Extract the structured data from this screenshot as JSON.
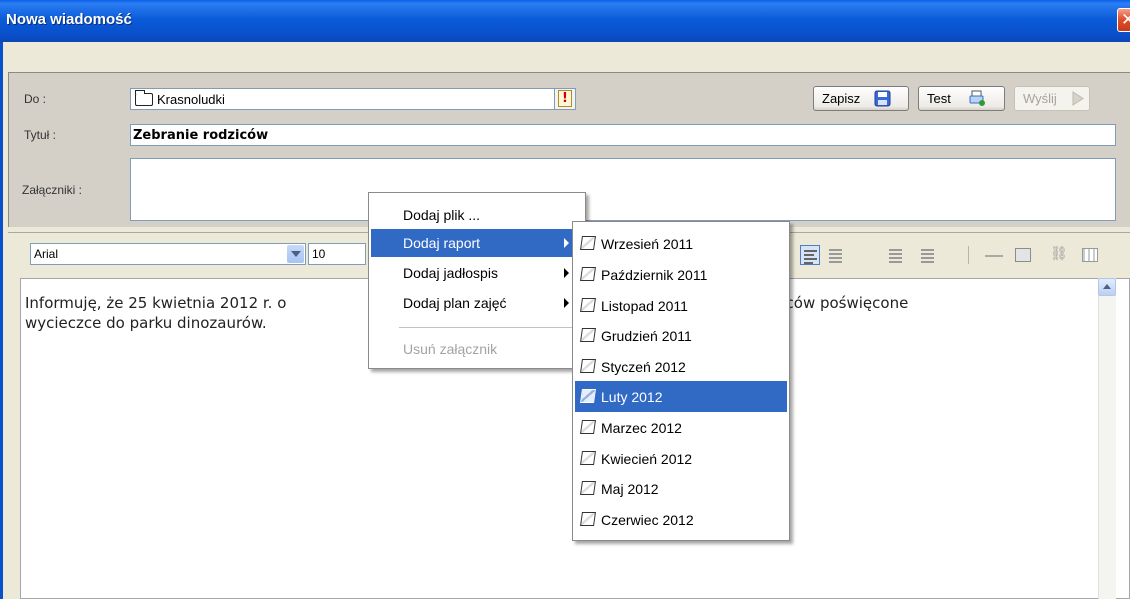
{
  "window": {
    "title": "Nowa wiadomość"
  },
  "header": {
    "to_label": "Do :",
    "to_value": "Krasnoludki",
    "title_label": "Tytuł :",
    "title_value": "Zebranie rodziców",
    "attachments_label": "Załączniki :"
  },
  "buttons": {
    "save": "Zapisz",
    "test": "Test",
    "send": "Wyślij"
  },
  "toolbar": {
    "font": "Arial",
    "size": "10"
  },
  "editor": {
    "text_line1": "Informuję, że 25 kwietnia 2012 r. o",
    "text_line1_end": "branie rodziców poświęcone",
    "text_line2": "wycieczce do parku dinozaurów."
  },
  "context_menu": {
    "items": [
      {
        "label": "Dodaj plik ..."
      },
      {
        "label": "Dodaj raport"
      },
      {
        "label": "Dodaj jadłospis"
      },
      {
        "label": "Dodaj plan zajęć"
      },
      {
        "label": "Usuń załącznik"
      }
    ]
  },
  "report_submenu": {
    "selected": "Luty 2012",
    "items": [
      {
        "label": "Wrzesień 2011"
      },
      {
        "label": "Październik 2011"
      },
      {
        "label": "Listopad 2011"
      },
      {
        "label": "Grudzień 2011"
      },
      {
        "label": "Styczeń 2012"
      },
      {
        "label": "Luty 2012"
      },
      {
        "label": "Marzec 2012"
      },
      {
        "label": "Kwiecień 2012"
      },
      {
        "label": "Maj 2012"
      },
      {
        "label": "Czerwiec 2012"
      }
    ]
  },
  "colors": {
    "titlebar": "#0a5ee8",
    "menu_highlight": "#316ac5",
    "window_bg": "#ece9d8"
  }
}
